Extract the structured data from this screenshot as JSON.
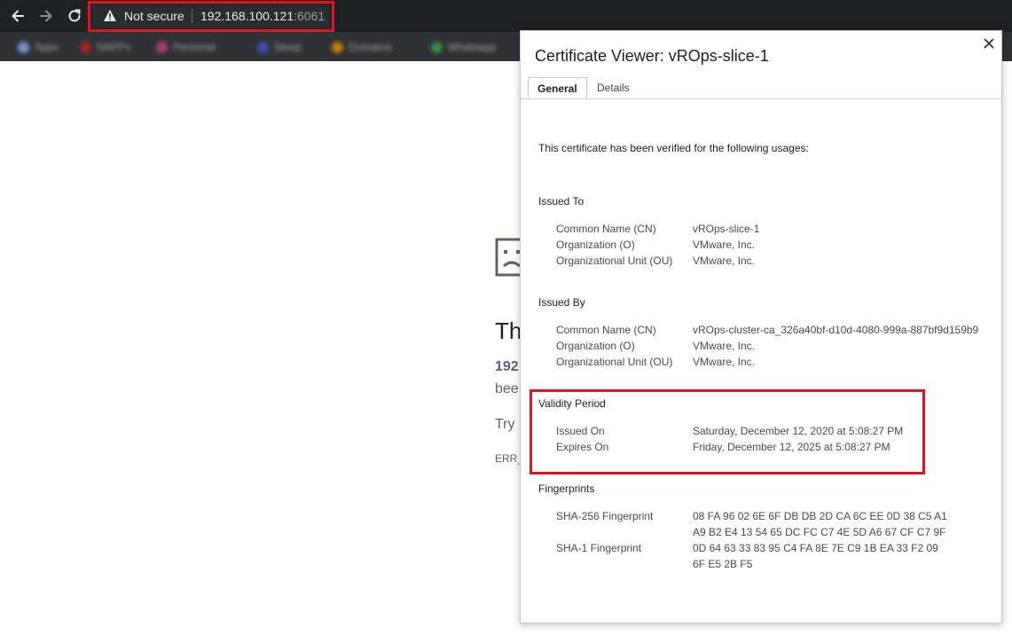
{
  "browser": {
    "security_label": "Not secure",
    "url_host": "192.168.100.121",
    "url_port": ":6061",
    "bookmarks": [
      "Apps",
      "NAPPs",
      "Personal",
      "Sleep",
      "Domaina",
      "Whatsapp"
    ]
  },
  "error_page": {
    "title_fragment": "Th",
    "host_fragment": "192",
    "line_fragment": "bee",
    "try_fragment": "Try",
    "code_fragment": "ERR_"
  },
  "dialog": {
    "title": "Certificate Viewer: vROps-slice-1",
    "tabs": {
      "general": "General",
      "details": "Details"
    },
    "intro": "This certificate has been verified for the following usages:",
    "issued_to": {
      "heading": "Issued To",
      "cn_label": "Common Name (CN)",
      "cn_value": "vROps-slice-1",
      "o_label": "Organization (O)",
      "o_value": "VMware, Inc.",
      "ou_label": "Organizational Unit (OU)",
      "ou_value": "VMware, Inc."
    },
    "issued_by": {
      "heading": "Issued By",
      "cn_label": "Common Name (CN)",
      "cn_value": "vROps-cluster-ca_326a40bf-d10d-4080-999a-887bf9d159b9",
      "o_label": "Organization (O)",
      "o_value": "VMware, Inc.",
      "ou_label": "Organizational Unit (OU)",
      "ou_value": "VMware, Inc."
    },
    "validity": {
      "heading": "Validity Period",
      "issued_label": "Issued On",
      "issued_value": "Saturday, December 12, 2020 at 5:08:27 PM",
      "expires_label": "Expires On",
      "expires_value": "Friday, December 12, 2025 at 5:08:27 PM"
    },
    "fingerprints": {
      "heading": "Fingerprints",
      "sha256_label": "SHA-256 Fingerprint",
      "sha256_line1": "08 FA 96 02 6E 6F DB DB 2D CA 6C EE 0D 38 C5 A1",
      "sha256_line2": "A9 B2 E4 13 54 65 DC FC C7 4E 5D A6 67 CF C7 9F",
      "sha1_label": "SHA-1 Fingerprint",
      "sha1_line1": "0D 64 63 33 83 95 C4 FA 8E 7E C9 1B EA 33 F2 09",
      "sha1_line2": "6F E5 2B F5"
    }
  },
  "colors": {
    "highlight": "#e3121b",
    "toolbar": "#202124",
    "bookmarks_bar": "#303134"
  }
}
